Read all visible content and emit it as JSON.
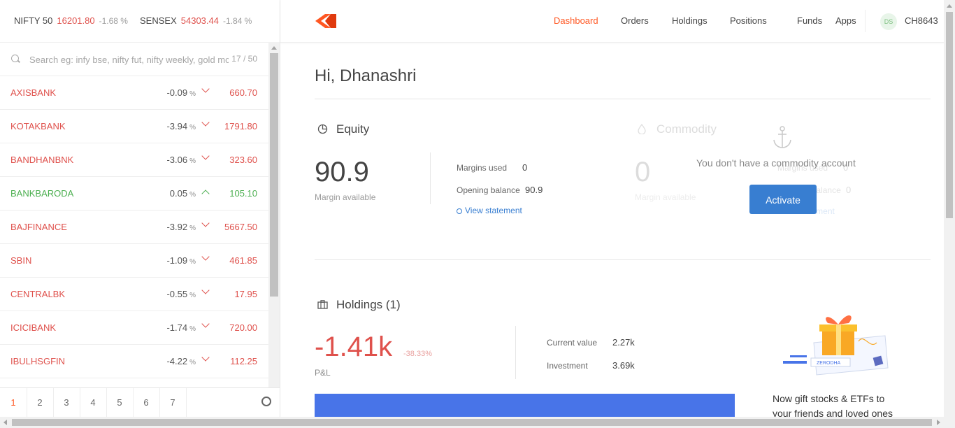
{
  "indices": [
    {
      "name": "NIFTY 50",
      "value": "16201.80",
      "change": "-1.68 %"
    },
    {
      "name": "SENSEX",
      "value": "54303.44",
      "change": "-1.84 %"
    }
  ],
  "search": {
    "placeholder": "Search eg: infy bse, nifty fut, nifty weekly, gold mcx",
    "count": "17 / 50"
  },
  "watchlist": [
    {
      "symbol": "AXISBANK",
      "change": "-0.09",
      "unit": "%",
      "price": "660.70",
      "direction": "down"
    },
    {
      "symbol": "KOTAKBANK",
      "change": "-3.94",
      "unit": "%",
      "price": "1791.80",
      "direction": "down"
    },
    {
      "symbol": "BANDHANBNK",
      "change": "-3.06",
      "unit": "%",
      "price": "323.60",
      "direction": "down"
    },
    {
      "symbol": "BANKBARODA",
      "change": "0.05",
      "unit": "%",
      "price": "105.10",
      "direction": "up"
    },
    {
      "symbol": "BAJFINANCE",
      "change": "-3.92",
      "unit": "%",
      "price": "5667.50",
      "direction": "down"
    },
    {
      "symbol": "SBIN",
      "change": "-1.09",
      "unit": "%",
      "price": "461.85",
      "direction": "down"
    },
    {
      "symbol": "CENTRALBK",
      "change": "-0.55",
      "unit": "%",
      "price": "17.95",
      "direction": "down"
    },
    {
      "symbol": "ICICIBANK",
      "change": "-1.74",
      "unit": "%",
      "price": "720.00",
      "direction": "down"
    },
    {
      "symbol": "IBULHSGFIN",
      "change": "-4.22",
      "unit": "%",
      "price": "112.25",
      "direction": "down"
    }
  ],
  "pages": [
    "1",
    "2",
    "3",
    "4",
    "5",
    "6",
    "7"
  ],
  "nav": {
    "items": [
      "Dashboard",
      "Orders",
      "Holdings",
      "Positions",
      "Funds",
      "Apps"
    ],
    "active": "Dashboard"
  },
  "user": {
    "initials": "DS",
    "id": "CH8643"
  },
  "greeting": "Hi, Dhanashri",
  "equity": {
    "title": "Equity",
    "margin_available": "90.9",
    "margin_available_label": "Margin available",
    "margins_used_label": "Margins used",
    "margins_used": "0",
    "opening_balance_label": "Opening balance",
    "opening_balance": "90.9",
    "view_statement": "View statement"
  },
  "commodity": {
    "title": "Commodity",
    "margin_available": "0",
    "margin_available_label": "Margin available",
    "margins_used_label": "Margins used",
    "margins_used": "0",
    "opening_balance_label": "Opening balance",
    "opening_balance": "0",
    "view_statement": "View statement",
    "message": "You don't have a commodity account",
    "activate_label": "Activate"
  },
  "holdings": {
    "title": "Holdings (1)",
    "pnl": "-1.41k",
    "pnl_pct": "-38.33%",
    "pnl_label": "P&L",
    "current_value_label": "Current value",
    "current_value": "2.27k",
    "investment_label": "Investment",
    "investment": "3.69k"
  },
  "promo": {
    "brand": "ZERODHA",
    "text": "Now gift stocks & ETFs to your friends and loved ones"
  },
  "colors": {
    "accent": "#ff5722",
    "loss": "#df514c",
    "gain": "#4caf50",
    "link": "#387ed1",
    "bar": "#4874e8"
  }
}
